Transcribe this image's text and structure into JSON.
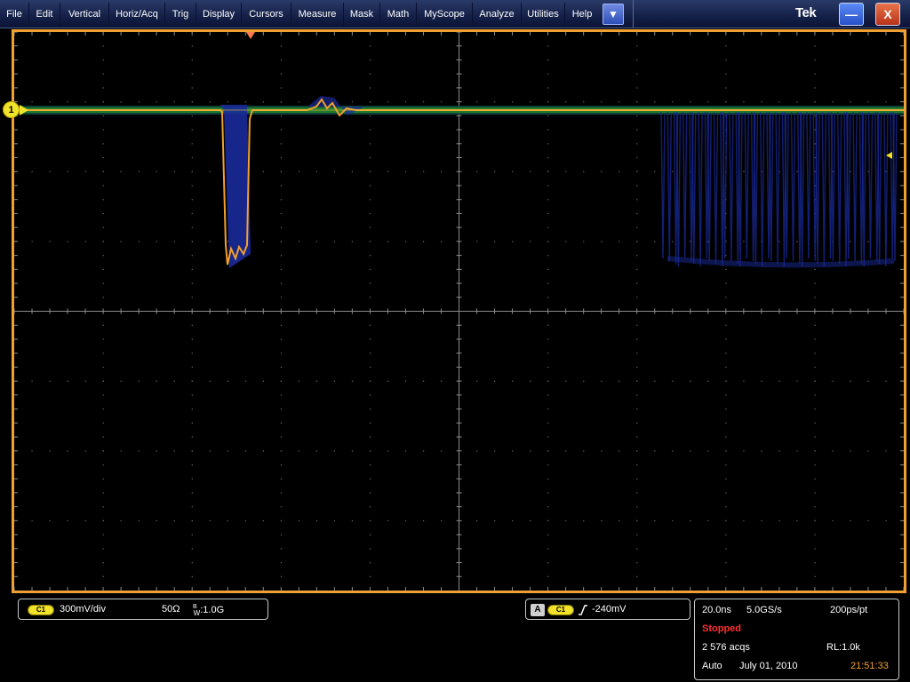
{
  "menu": {
    "items": [
      "File",
      "Edit",
      "Vertical",
      "Horiz/Acq",
      "Trig",
      "Display",
      "Cursors",
      "Measure",
      "Mask",
      "Math",
      "MyScope",
      "Analyze",
      "Utilities",
      "Help"
    ],
    "dropdown_icon": "chevron-down-icon",
    "brand": "Tek",
    "minimize_icon": "minimize-icon",
    "close_label": "X"
  },
  "graticule": {
    "channel_marker_label": "1",
    "border_color": "#f0a030",
    "trace_color": "#f0a030",
    "persistence_color": "#1a2a9a"
  },
  "vertical_readout": {
    "channel_badge": "C1",
    "scale": "300mV/div",
    "impedance": "50Ω",
    "bw_prefix": "B",
    "bw_sub": "W",
    "bw_value": ":1.0G"
  },
  "trigger_readout": {
    "source_badge": "A",
    "channel_badge": "C1",
    "slope_icon": "rising-edge-icon",
    "level": "-240mV"
  },
  "horizontal_readout": {
    "timebase": "20.0ns",
    "sample_rate": "5.0GS/s",
    "resolution": "200ps/pt",
    "status": "Stopped",
    "acqs": "2 576 acqs",
    "record_length": "RL:1.0k",
    "mode": "Auto",
    "date": "July 01, 2010",
    "time": "21:51:33"
  }
}
